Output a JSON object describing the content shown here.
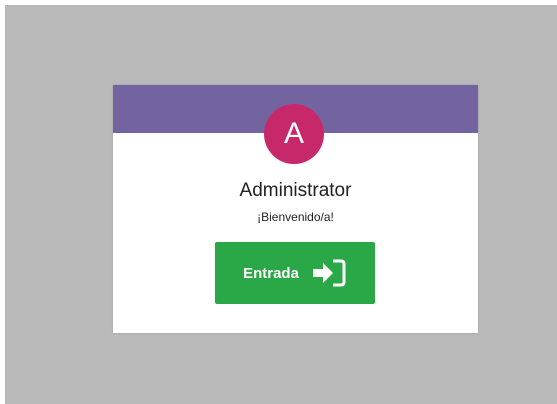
{
  "login_card": {
    "avatar_letter": "A",
    "username": "Administrator",
    "greeting": "¡Bienvenido/a!",
    "login_button_label": "Entrada",
    "login_icon": "sign-in-icon"
  },
  "colors": {
    "background": "#b9b9b9",
    "header": "#7364a0",
    "avatar": "#c7286a",
    "button": "#2aa847"
  }
}
